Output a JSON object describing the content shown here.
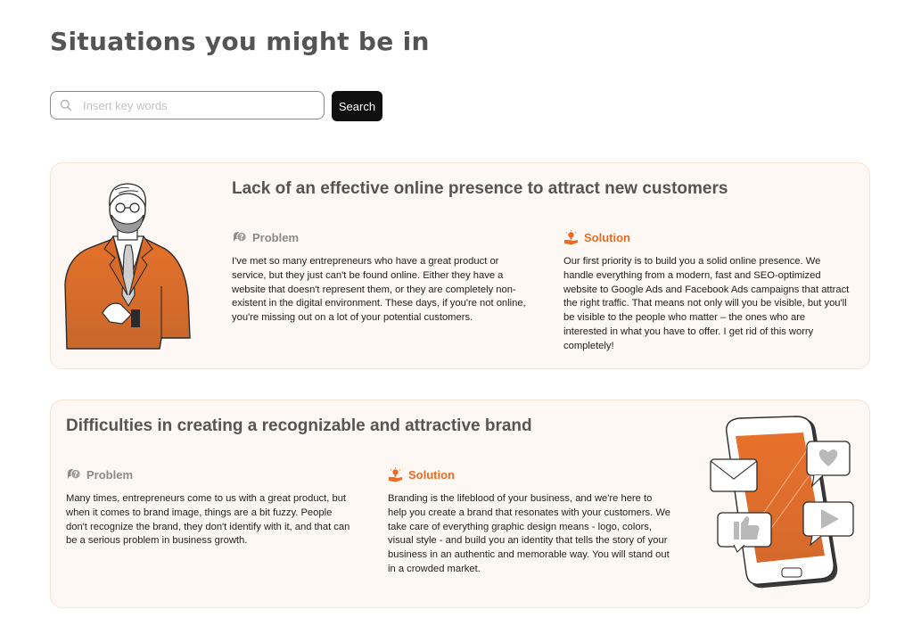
{
  "page": {
    "title": "Situations you might be in"
  },
  "search": {
    "placeholder": "Insert key words",
    "value": "",
    "button_label": "Search"
  },
  "colors": {
    "accent": "#e86c26",
    "card_bg": "#fdf8f3",
    "card_border": "#f4e4d6",
    "button_bg": "#101010",
    "title_text": "#555555"
  },
  "cards": [
    {
      "title": "Lack of an effective online presence to attract new customers",
      "illustration": "businessman-illustration",
      "problem": {
        "label": "Problem",
        "icon": "speech-question-icon",
        "text": "I've met so many entrepreneurs who have a great product or service, but they just can't be found online. Either they have a website that doesn't represent them, or they are completely non-existent in the digital environment. These days, if you're not online, you're missing out on a lot of your potential customers."
      },
      "solution": {
        "label": "Solution",
        "icon": "idea-hand-icon",
        "text": "Our first priority is to build you a solid online presence. We handle everything from a modern, fast and SEO-optimized website to Google Ads and Facebook Ads campaigns that attract the right traffic. That means not only will you be visible, but you'll be visible to the people who matter – the ones who are interested in what you have to offer. I get rid of this worry completely!"
      }
    },
    {
      "title": "Difficulties in creating a recognizable and attractive brand",
      "illustration": "smartphone-social-illustration",
      "problem": {
        "label": "Problem",
        "icon": "speech-question-icon",
        "text": "Many times, entrepreneurs come to us with a great product, but when it comes to brand image, things are a bit fuzzy. People don't recognize the brand, they don't identify with it, and that can be a serious problem in business growth."
      },
      "solution": {
        "label": "Solution",
        "icon": "idea-hand-icon",
        "text": "Branding is the lifeblood of your business, and we're here to help you create a brand that resonates with your customers. We take care of everything graphic design means - logo, colors, visual style - and build you an identity that tells the story of your business in an authentic and memorable way. You will stand out in a crowded market."
      }
    }
  ]
}
